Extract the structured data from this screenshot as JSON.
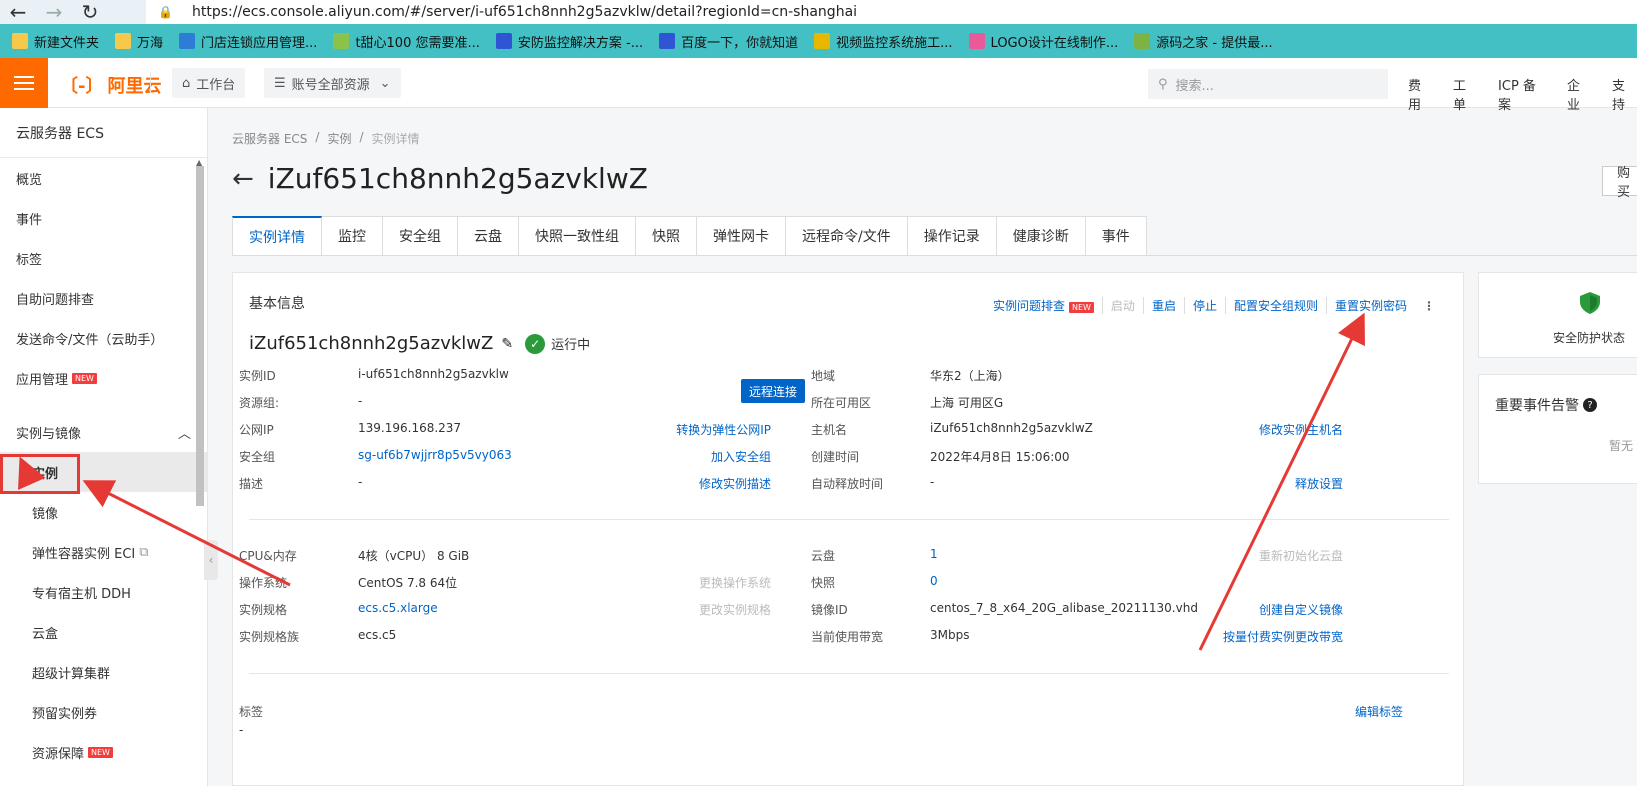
{
  "browser": {
    "url": "https://ecs.console.aliyun.com/#/server/i-uf651ch8nnh2g5azvklw/detail?regionId=cn-shanghai",
    "bookmarks": [
      {
        "label": "新建文件夹",
        "color": "#f7c94b"
      },
      {
        "label": "万海",
        "color": "#f7c94b"
      },
      {
        "label": "门店连锁应用管理...",
        "color": "#2e7cd6"
      },
      {
        "label": "t甜心100 您需要准...",
        "color": "#8bc34a"
      },
      {
        "label": "安防监控解决方案 -...",
        "color": "#2f55d4"
      },
      {
        "label": "百度一下，你就知道",
        "color": "#2f55d4"
      },
      {
        "label": "视频监控系统施工...",
        "color": "#e6b800"
      },
      {
        "label": "LOGO设计在线制作...",
        "color": "#e85a9a"
      },
      {
        "label": "源码之家 - 提供最...",
        "color": "#7cb342"
      }
    ]
  },
  "topnav": {
    "logo": "阿里云",
    "workbench": "工作台",
    "resources": "账号全部资源",
    "search_placeholder": "搜索...",
    "links": [
      "费用",
      "工单",
      "ICP 备案",
      "企业",
      "支持"
    ]
  },
  "sidebar": {
    "title": "云服务器 ECS",
    "items": [
      "概览",
      "事件",
      "标签",
      "自助问题排查",
      "发送命令/文件（云助手）"
    ],
    "app_mgmt": "应用管理",
    "new_badge": "NEW",
    "group": "实例与镜像",
    "sub_items": [
      "实例",
      "镜像",
      "弹性容器实例 ECI",
      "专有宿主机 DDH",
      "云盒",
      "超级计算集群",
      "预留实例券"
    ],
    "last_item": "资源保障"
  },
  "main": {
    "breadcrumb": [
      "云服务器 ECS",
      "实例",
      "实例详情"
    ],
    "title": "iZuf651ch8nnh2g5azvklwZ",
    "buy": "购买",
    "tabs": [
      "实例详情",
      "监控",
      "安全组",
      "云盘",
      "快照一致性组",
      "快照",
      "弹性网卡",
      "远程命令/文件",
      "操作记录",
      "健康诊断",
      "事件"
    ],
    "basic_info": "基本信息",
    "actions": [
      "实例问题排查",
      "启动",
      "重启",
      "停止",
      "配置安全组规则",
      "重置实例密码"
    ],
    "instance_name": "iZuf651ch8nnh2g5azvklwZ",
    "status": "运行中",
    "remote_connect": "远程连接",
    "left_fields": [
      {
        "label": "实例ID",
        "value": "i-uf651ch8nnh2g5azvklw"
      },
      {
        "label": "资源组:",
        "value": "-"
      },
      {
        "label": "公网IP",
        "value": "139.196.168.237",
        "action": "转换为弹性公网IP"
      },
      {
        "label": "安全组",
        "value": "sg-uf6b7wjjrr8p5v5vy063",
        "action": "加入安全组"
      },
      {
        "label": "描述",
        "value": "-",
        "action": "修改实例描述"
      }
    ],
    "right_fields": [
      {
        "label": "地域",
        "value": "华东2（上海）"
      },
      {
        "label": "所在可用区",
        "value": "上海 可用区G"
      },
      {
        "label": "主机名",
        "value": "iZuf651ch8nnh2g5azvklwZ",
        "action": "修改实例主机名"
      },
      {
        "label": "创建时间",
        "value": "2022年4月8日 15:06:00"
      },
      {
        "label": "自动释放时间",
        "value": "-",
        "action": "释放设置"
      }
    ],
    "left_fields2": [
      {
        "label": "CPU&内存",
        "value": "4核（vCPU） 8 GiB"
      },
      {
        "label": "操作系统",
        "value": "CentOS 7.8 64位",
        "action": "更换操作系统"
      },
      {
        "label": "实例规格",
        "value": "ecs.c5.xlarge",
        "action": "更改实例规格"
      },
      {
        "label": "实例规格族",
        "value": "ecs.c5"
      }
    ],
    "right_fields2": [
      {
        "label": "云盘",
        "value": "1",
        "action": "重新初始化云盘"
      },
      {
        "label": "快照",
        "value": "0"
      },
      {
        "label": "镜像ID",
        "value": "centos_7_8_x64_20G_alibase_20211130.vhd",
        "action": "创建自定义镜像"
      },
      {
        "label": "当前使用带宽",
        "value": "3Mbps",
        "action": "按量付费实例更改带宽"
      }
    ],
    "tag_label": "标签",
    "tag_value": "-",
    "tag_action": "编辑标签"
  },
  "right_panel": {
    "security_status": "安全防护状态",
    "events_title": "重要事件告警",
    "events_none": "暂无"
  },
  "colors": {
    "accent": "#0064c8",
    "brand": "#ff6a00",
    "annotation": "#e53935"
  }
}
